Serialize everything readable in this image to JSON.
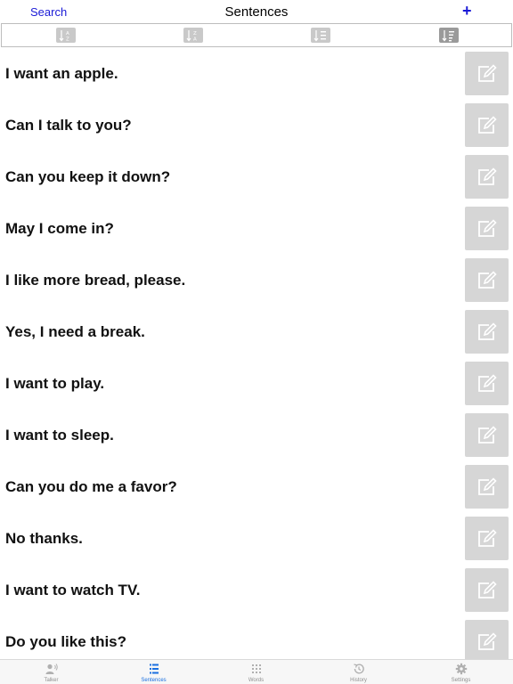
{
  "header": {
    "search_label": "Search",
    "title": "Sentences",
    "add_label": "+"
  },
  "sortbar": {
    "buttons": [
      {
        "name": "sort-alpha-icon",
        "active": false
      },
      {
        "name": "sort-alpha-reverse-icon",
        "active": false
      },
      {
        "name": "sort-list-icon",
        "active": false
      },
      {
        "name": "sort-custom-icon",
        "active": true
      }
    ]
  },
  "sentences": [
    "I want an apple.",
    "Can I talk to you?",
    "Can you keep it down?",
    "May I come in?",
    "I like more bread, please.",
    "Yes, I need a break.",
    "I want to play.",
    "I want to sleep.",
    "Can you do me a favor?",
    "No thanks.",
    "I want to watch TV.",
    "Do you like this?"
  ],
  "tabbar": {
    "tabs": [
      {
        "label": "Talker",
        "icon": "talker-icon",
        "active": false
      },
      {
        "label": "Sentences",
        "icon": "list-icon",
        "active": true
      },
      {
        "label": "Words",
        "icon": "grid-icon",
        "active": false
      },
      {
        "label": "History",
        "icon": "history-icon",
        "active": false
      },
      {
        "label": "Settings",
        "icon": "gear-icon",
        "active": false
      }
    ]
  },
  "colors": {
    "accent": "#1a1ad6",
    "tab_active": "#1a6fe0",
    "edit_button_bg": "#d6d6d6"
  }
}
